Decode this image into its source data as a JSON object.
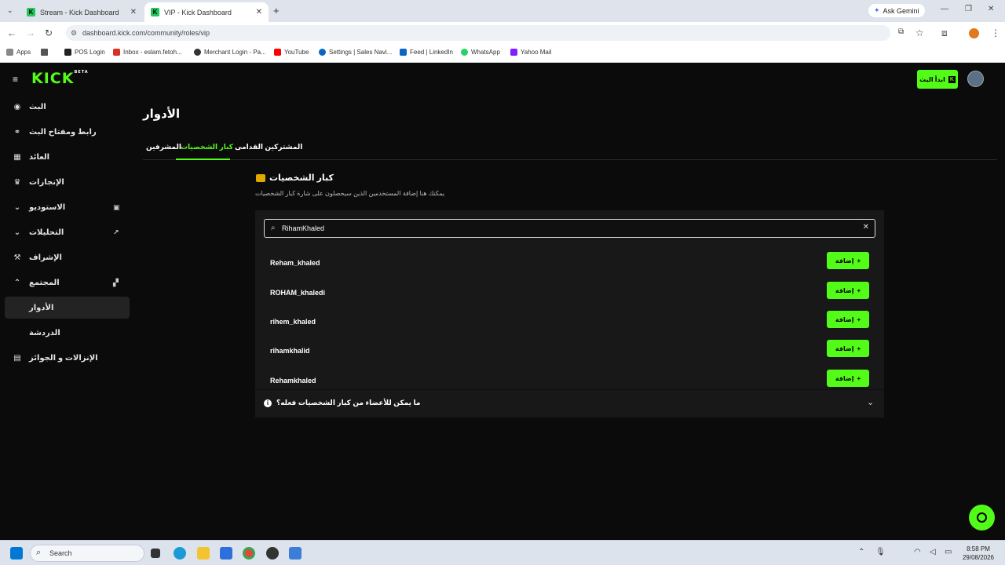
{
  "browser": {
    "tabs": [
      {
        "title": "Stream - Kick Dashboard",
        "active": false
      },
      {
        "title": "VIP - Kick Dashboard",
        "active": true
      }
    ],
    "ask_gemini": "Ask Gemini",
    "url": "dashboard.kick.com/community/roles/vip",
    "bookmarks": [
      "Apps",
      "POS Login",
      "Inbox - eslam.fetoh...",
      "Merchant Login - Pa...",
      "YouTube",
      "Settings | Sales Navi...",
      "Feed | LinkedIn",
      "WhatsApp",
      "Yahoo Mail"
    ]
  },
  "header": {
    "logo": "KICK",
    "logo_beta": "BETA",
    "go_live_label": "ابدأ البث"
  },
  "sidebar": {
    "items": [
      {
        "label": "البث",
        "icon": "broadcast-icon"
      },
      {
        "label": "رابط ومفتاح البث",
        "icon": "link-icon"
      },
      {
        "label": "العائد",
        "icon": "revenue-icon"
      },
      {
        "label": "الإنجازات",
        "icon": "trophy-icon"
      },
      {
        "label": "الاستوديو",
        "icon": "studio-icon"
      },
      {
        "label": "التحليلات",
        "icon": "analytics-icon"
      },
      {
        "label": "الإشراف",
        "icon": "moderation-icon"
      },
      {
        "label": "المجتمع",
        "icon": "community-icon"
      },
      {
        "label": "الأدوار",
        "icon": ""
      },
      {
        "label": "الدردشة",
        "icon": ""
      },
      {
        "label": "الإنزالات و الجوائز",
        "icon": "drops-icon"
      }
    ]
  },
  "main": {
    "title": "الأدوار",
    "tabs": [
      "المشرفين",
      "كبار الشخصيات",
      "المشتركين القدامى"
    ],
    "vip_title": "كبار الشخصيات",
    "vip_description": "يمكنك هنا إضافة المستخدمين الذين سيحصلون على شارة كبار الشخصيات",
    "search_value": "RihamKhaled",
    "results": [
      "Reham_khaled",
      "ROHAM_khaledi",
      "rihem_khaled",
      "rihamkhalid",
      "Rehamkhaled"
    ],
    "add_label": "إضافة",
    "faq_question": "ما يمكن للأعضاء من كبار الشخصيات فعله؟"
  },
  "taskbar": {
    "search_placeholder": "Search",
    "time": "8:58 PM",
    "date": "29/08/2026"
  },
  "colors": {
    "accent": "#53fc18",
    "background": "#0b0b0b",
    "panel": "#181818"
  }
}
